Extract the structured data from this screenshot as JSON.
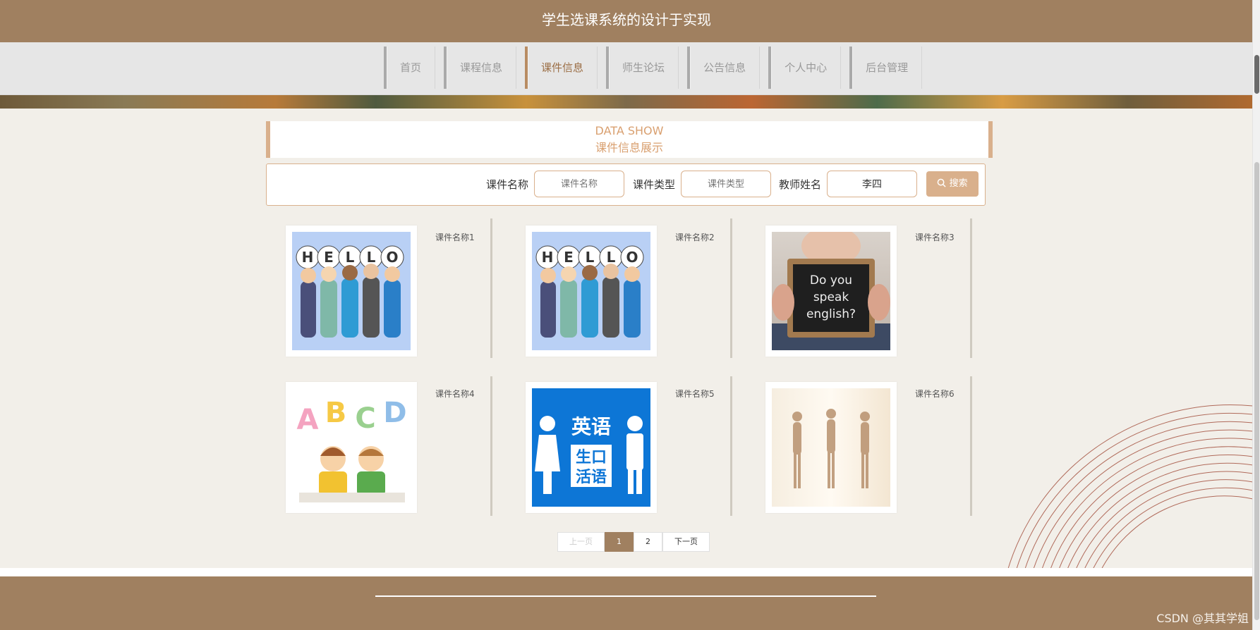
{
  "site": {
    "title": "学生选课系统的设计于实现"
  },
  "nav": {
    "items": [
      {
        "label": "首页"
      },
      {
        "label": "课程信息"
      },
      {
        "label": "课件信息"
      },
      {
        "label": "师生论坛"
      },
      {
        "label": "公告信息"
      },
      {
        "label": "个人中心"
      },
      {
        "label": "后台管理"
      }
    ],
    "active": "课件信息"
  },
  "section": {
    "title_en": "DATA SHOW",
    "title_cn": "课件信息展示"
  },
  "search": {
    "name_label": "课件名称",
    "name_placeholder": "课件名称",
    "name_value": "",
    "type_label": "课件类型",
    "type_placeholder": "课件类型",
    "type_value": "",
    "teacher_label": "教师姓名",
    "teacher_value": "李四",
    "button_label": "搜索"
  },
  "cards": [
    {
      "title": "课件名称1",
      "image": "hello-kids-illustration"
    },
    {
      "title": "课件名称2",
      "image": "hello-kids-illustration"
    },
    {
      "title": "课件名称3",
      "image": "do-you-speak-english-chalkboard"
    },
    {
      "title": "课件名称4",
      "image": "abcd-kids-illustration"
    },
    {
      "title": "课件名称5",
      "image": "spoken-english-sign"
    },
    {
      "title": "课件名称6",
      "image": "dancers-photo"
    }
  ],
  "images": {
    "card3_text": "Do you speak english?",
    "card5_text": [
      "英语",
      "生口",
      "活语"
    ]
  },
  "pagination": {
    "prev_label": "上一页",
    "next_label": "下一页",
    "pages": [
      "1",
      "2"
    ],
    "current": "1"
  },
  "watermark": "CSDN @其其学姐",
  "colors": {
    "brand": "#a08060",
    "accent": "#d9b08c"
  }
}
